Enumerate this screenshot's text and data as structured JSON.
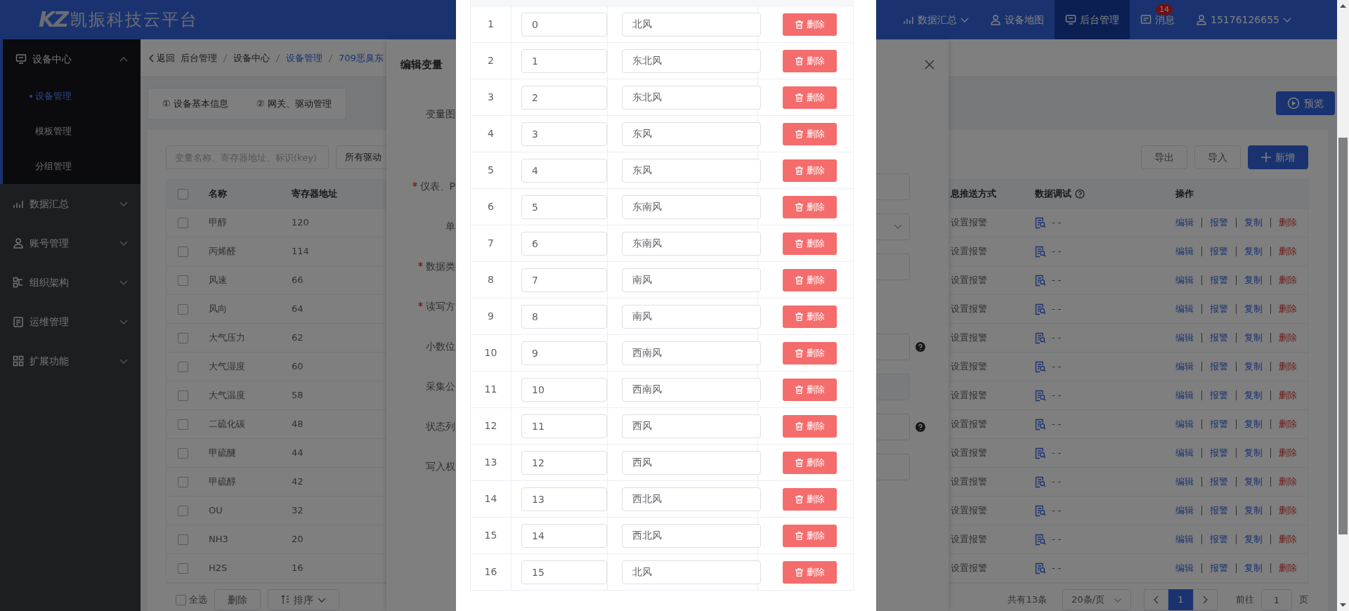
{
  "header": {
    "logo": "KZ",
    "title": "凯振科技云平台",
    "nav": [
      {
        "label": "数据汇总",
        "dropdown": true,
        "selected": false
      },
      {
        "label": "设备地图",
        "dropdown": false,
        "selected": false
      },
      {
        "label": "后台管理",
        "dropdown": false,
        "selected": true
      },
      {
        "label": "消息",
        "dropdown": false,
        "selected": false,
        "badge": "14"
      },
      {
        "label": "15176126655",
        "dropdown": true,
        "selected": false
      }
    ]
  },
  "sidebar": {
    "items": [
      {
        "label": "设备中心",
        "expanded": true,
        "children": [
          {
            "label": "设备管理",
            "selected": true
          },
          {
            "label": "模板管理",
            "selected": false
          },
          {
            "label": "分组管理",
            "selected": false
          }
        ]
      },
      {
        "label": "数据汇总",
        "expanded": false
      },
      {
        "label": "账号管理",
        "expanded": false
      },
      {
        "label": "组织架构",
        "expanded": false
      },
      {
        "label": "运维管理",
        "expanded": false
      },
      {
        "label": "扩展功能",
        "expanded": false
      }
    ]
  },
  "breadcrumb": {
    "back": "返回",
    "items": [
      {
        "label": "后台管理",
        "link": false
      },
      {
        "label": "设备中心",
        "link": false
      },
      {
        "label": "设备管理",
        "link": true
      },
      {
        "label": "709恶臭东",
        "link": true
      }
    ]
  },
  "tabs": [
    {
      "label": "① 设备基本信息",
      "selected": false
    },
    {
      "label": "② 网关、驱动管理",
      "selected": false
    }
  ],
  "preview_button": "预览",
  "toolbar": {
    "search_placeholder": "变量名称、寄存器地址、标识(key)",
    "driver_select": "所有驱动",
    "buttons": [
      {
        "label": "导出",
        "kind": "plain"
      },
      {
        "label": "导入",
        "kind": "plain"
      },
      {
        "label": "新增",
        "kind": "primary"
      }
    ]
  },
  "table": {
    "select_all_checked": false,
    "columns": [
      "名称",
      "寄存器地址",
      "息推送方式",
      "数据调试",
      "操作"
    ],
    "rows": [
      {
        "name": "甲醇",
        "address": "120",
        "push": "设置报警",
        "debug": "- -",
        "checked": false,
        "actions": [
          "编辑",
          "报警",
          "复制",
          "删除"
        ]
      },
      {
        "name": "丙烯醛",
        "address": "114",
        "push": "设置报警",
        "debug": "- -",
        "checked": false,
        "actions": [
          "编辑",
          "报警",
          "复制",
          "删除"
        ]
      },
      {
        "name": "风速",
        "address": "66",
        "push": "设置报警",
        "debug": "- -",
        "checked": false,
        "actions": [
          "编辑",
          "报警",
          "复制",
          "删除"
        ]
      },
      {
        "name": "风向",
        "address": "64",
        "push": "设置报警",
        "debug": "- -",
        "checked": false,
        "actions": [
          "编辑",
          "报警",
          "复制",
          "删除"
        ]
      },
      {
        "name": "大气压力",
        "address": "62",
        "push": "设置报警",
        "debug": "- -",
        "checked": false,
        "actions": [
          "编辑",
          "报警",
          "复制",
          "删除"
        ]
      },
      {
        "name": "大气湿度",
        "address": "60",
        "push": "设置报警",
        "debug": "- -",
        "checked": false,
        "actions": [
          "编辑",
          "报警",
          "复制",
          "删除"
        ]
      },
      {
        "name": "大气温度",
        "address": "58",
        "push": "设置报警",
        "debug": "- -",
        "checked": false,
        "actions": [
          "编辑",
          "报警",
          "复制",
          "删除"
        ]
      },
      {
        "name": "二硫化碳",
        "address": "48",
        "push": "设置报警",
        "debug": "- -",
        "checked": false,
        "actions": [
          "编辑",
          "报警",
          "复制",
          "删除"
        ]
      },
      {
        "name": "甲硫醚",
        "address": "44",
        "push": "设置报警",
        "debug": "- -",
        "checked": false,
        "actions": [
          "编辑",
          "报警",
          "复制",
          "删除"
        ]
      },
      {
        "name": "甲硫醇",
        "address": "42",
        "push": "设置报警",
        "debug": "- -",
        "checked": false,
        "actions": [
          "编辑",
          "报警",
          "复制",
          "删除"
        ]
      },
      {
        "name": "OU",
        "address": "32",
        "push": "设置报警",
        "debug": "- -",
        "checked": false,
        "actions": [
          "编辑",
          "报警",
          "复制",
          "删除"
        ]
      },
      {
        "name": "NH3",
        "address": "20",
        "push": "设置报警",
        "debug": "- -",
        "checked": false,
        "actions": [
          "编辑",
          "报警",
          "复制",
          "删除"
        ]
      },
      {
        "name": "H2S",
        "address": "16",
        "push": "设置报警",
        "debug": "- -",
        "checked": false,
        "actions": [
          "编辑",
          "报警",
          "复制",
          "删除"
        ]
      }
    ]
  },
  "footer": {
    "select_all": "全选",
    "select_all_checked": false,
    "delete": "删除",
    "sort": "排序",
    "total": "共有13条",
    "page_size": "20条/页",
    "pages": [
      {
        "label": "1",
        "selected": true
      }
    ],
    "goto_label": "前往",
    "goto_value": "1",
    "page_suffix": "页"
  },
  "drawer": {
    "title": "编辑变量",
    "fields": [
      {
        "label": "变量图",
        "required": false,
        "kind": "none"
      },
      {
        "label": "仪表、P",
        "required": true,
        "kind": "input",
        "help": false
      },
      {
        "label": "单",
        "required": false,
        "kind": "select",
        "help": false
      },
      {
        "label": "数据类",
        "required": true,
        "kind": "input",
        "help": false
      },
      {
        "label": "读写方",
        "required": true,
        "kind": "none",
        "help": false
      },
      {
        "label": "小数位",
        "required": false,
        "kind": "input",
        "help": true
      },
      {
        "label": "采集公",
        "required": false,
        "kind": "disabled",
        "help": false
      },
      {
        "label": "状态列",
        "required": false,
        "kind": "input",
        "help": true
      },
      {
        "label": "写入权",
        "required": false,
        "kind": "input",
        "help": false
      }
    ]
  },
  "modal": {
    "rows": [
      {
        "index": "1",
        "value": "0",
        "text": "北风",
        "action": "删除"
      },
      {
        "index": "2",
        "value": "1",
        "text": "东北风",
        "action": "删除"
      },
      {
        "index": "3",
        "value": "2",
        "text": "东北风",
        "action": "删除"
      },
      {
        "index": "4",
        "value": "3",
        "text": "东风",
        "action": "删除"
      },
      {
        "index": "5",
        "value": "4",
        "text": "东风",
        "action": "删除"
      },
      {
        "index": "6",
        "value": "5",
        "text": "东南风",
        "action": "删除"
      },
      {
        "index": "7",
        "value": "6",
        "text": "东南风",
        "action": "删除"
      },
      {
        "index": "8",
        "value": "7",
        "text": "南风",
        "action": "删除"
      },
      {
        "index": "9",
        "value": "8",
        "text": "南风",
        "action": "删除"
      },
      {
        "index": "10",
        "value": "9",
        "text": "西南风",
        "action": "删除"
      },
      {
        "index": "11",
        "value": "10",
        "text": "西南风",
        "action": "删除"
      },
      {
        "index": "12",
        "value": "11",
        "text": "西风",
        "action": "删除"
      },
      {
        "index": "13",
        "value": "12",
        "text": "西风",
        "action": "删除"
      },
      {
        "index": "14",
        "value": "13",
        "text": "西北风",
        "action": "删除"
      },
      {
        "index": "15",
        "value": "14",
        "text": "西北风",
        "action": "删除"
      },
      {
        "index": "16",
        "value": "15",
        "text": "北风",
        "action": "删除"
      }
    ]
  }
}
